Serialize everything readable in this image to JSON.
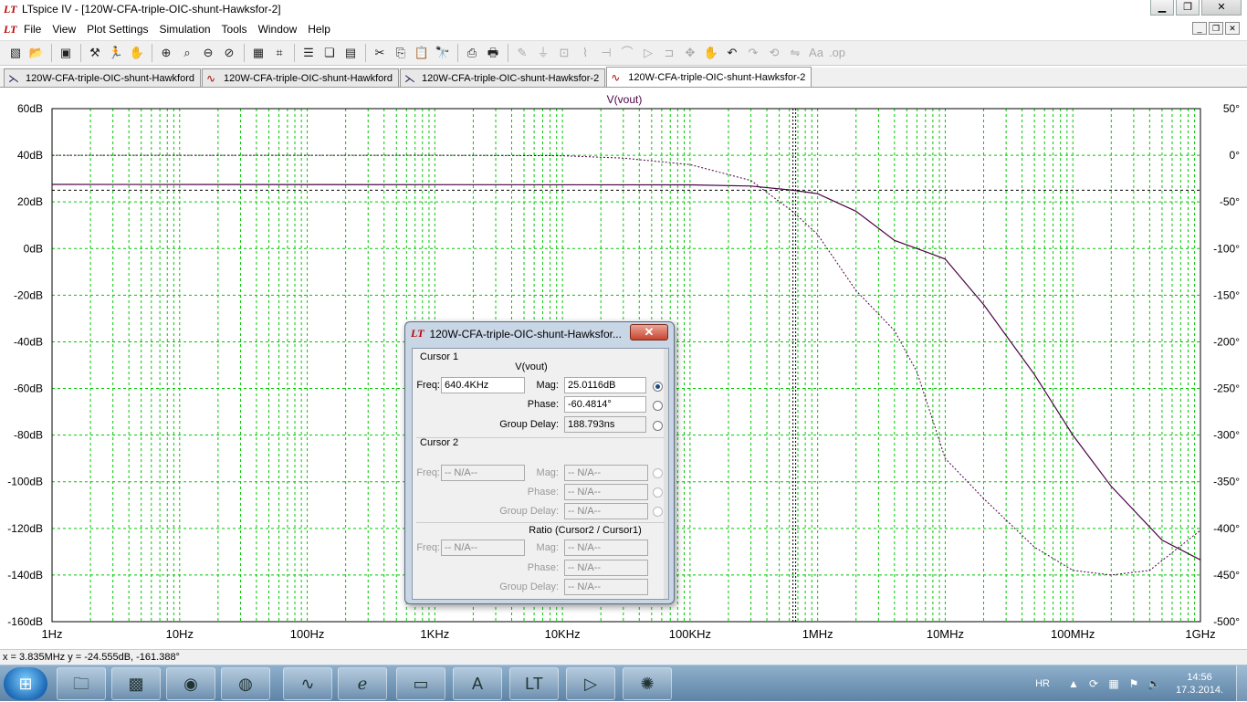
{
  "window": {
    "app_title": "LTspice IV - [120W-CFA-triple-OIC-shunt-Hawksfor-2]",
    "min_label": "▁",
    "max_label": "❐",
    "close_label": "✕"
  },
  "menu": {
    "items": [
      "File",
      "View",
      "Plot Settings",
      "Simulation",
      "Tools",
      "Window",
      "Help"
    ]
  },
  "tabs": [
    {
      "label": "120W-CFA-triple-OIC-shunt-Hawkford",
      "icon": "schematic-icon"
    },
    {
      "label": "120W-CFA-triple-OIC-shunt-Hawkford",
      "icon": "waveform-icon"
    },
    {
      "label": "120W-CFA-triple-OIC-shunt-Hawksfor-2",
      "icon": "schematic-icon"
    },
    {
      "label": "120W-CFA-triple-OIC-shunt-Hawksfor-2",
      "icon": "waveform-icon"
    }
  ],
  "plot": {
    "trace_label": "V(vout)",
    "colors": {
      "grid": "#00c800",
      "trace": "#4b0046",
      "cursor": "#000000"
    }
  },
  "chart_data": {
    "type": "line",
    "title": "V(vout)",
    "xscale": "log",
    "xlim": [
      1,
      1000000000
    ],
    "x_tick_labels": [
      "1Hz",
      "10Hz",
      "100Hz",
      "1KHz",
      "10KHz",
      "100KHz",
      "1MHz",
      "10MHz",
      "100MHz",
      "1GHz"
    ],
    "ylim_left": [
      -160,
      60
    ],
    "y_left_tick_labels": [
      "60dB",
      "40dB",
      "20dB",
      "0dB",
      "-20dB",
      "-40dB",
      "-60dB",
      "-80dB",
      "-100dB",
      "-120dB",
      "-140dB",
      "-160dB"
    ],
    "ylim_right": [
      -500,
      50
    ],
    "y_right_tick_labels": [
      "50°",
      "0°",
      "-50°",
      "-100°",
      "-150°",
      "-200°",
      "-250°",
      "-300°",
      "-350°",
      "-400°",
      "-450°",
      "-500°"
    ],
    "grid": true,
    "series": [
      {
        "name": "V(vout)",
        "axis": "magnitude",
        "style": "solid",
        "x": [
          1,
          100000,
          300000,
          640400,
          1000000,
          2000000,
          4000000,
          8000000,
          10000000,
          20000000,
          50000000,
          100000000,
          200000000,
          500000000,
          1000000000
        ],
        "y": [
          27.5,
          27.3,
          26.8,
          25.0,
          23.5,
          16.0,
          3.5,
          -2.5,
          -4.5,
          -24.0,
          -54.0,
          -80.0,
          -102.0,
          -125.0,
          -133.5
        ]
      },
      {
        "name": "V(vout)",
        "axis": "phase",
        "style": "dotted",
        "x": [
          1,
          1000,
          10000,
          30000,
          100000,
          300000,
          640400,
          1000000,
          2000000,
          4000000,
          6000000,
          10000000,
          20000000,
          50000000,
          100000000,
          200000000,
          400000000,
          1000000000
        ],
        "y": [
          0,
          0,
          -0.5,
          -3,
          -10,
          -27,
          -60.5,
          -85,
          -145,
          -188,
          -232,
          -325,
          -368,
          -420,
          -445,
          -450,
          -445,
          -402
        ]
      }
    ],
    "cursor": {
      "x": 640400,
      "y_mag": 25.0116,
      "y_phase": -60.4814
    }
  },
  "cursor_dialog": {
    "title": "120W-CFA-triple-OIC-shunt-Hawksfor...",
    "close_label": "✕",
    "cursor1_label": "Cursor 1",
    "trace_name": "V(vout)",
    "freq_label": "Freq:",
    "freq_value": "640.4KHz",
    "mag_label": "Mag:",
    "mag_value": "25.0116dB",
    "phase_label": "Phase:",
    "phase_value": "-60.4814°",
    "gd_label": "Group Delay:",
    "gd_value": "188.793ns",
    "cursor2_label": "Cursor 2",
    "na": "-- N/A--",
    "ratio_label": "Ratio (Cursor2 / Cursor1)"
  },
  "status": {
    "readout": "x = 3.835MHz   y = -24.555dB, -161.388°"
  },
  "taskbar": {
    "lang": "HR",
    "time": "14:56",
    "date": "17.3.2014."
  }
}
